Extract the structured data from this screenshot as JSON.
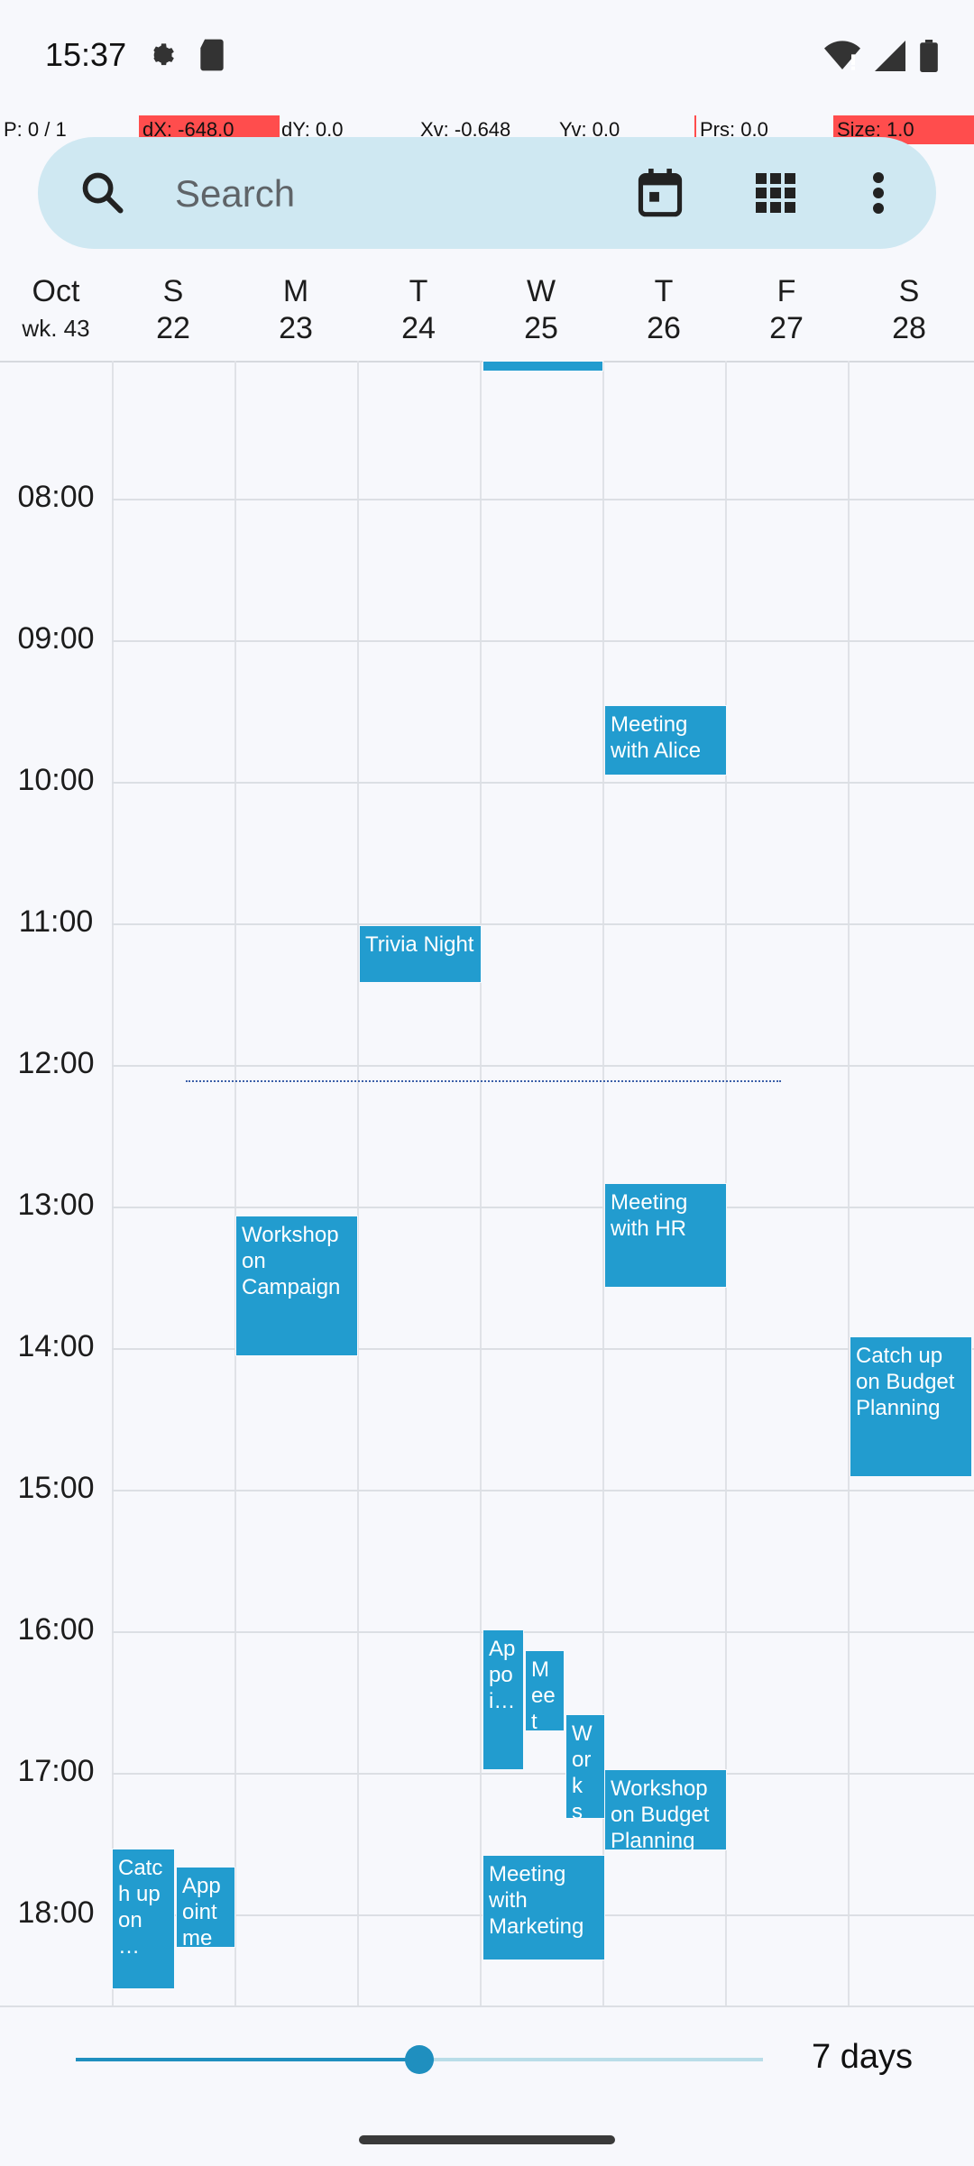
{
  "status_bar": {
    "time": "15:37",
    "icons": [
      "settings-icon",
      "sd-card-icon",
      "wifi-icon",
      "signal-icon",
      "battery-icon"
    ]
  },
  "debug": {
    "p": "P: 0 / 1",
    "dx": "dX: -648.0",
    "dy": "dY: 0.0",
    "xv": "Xv: -0.648",
    "yv": "Yv: 0.0",
    "prs": "Prs: 0.0",
    "size": "Size: 1.0"
  },
  "search": {
    "placeholder": "Search"
  },
  "toolbar": {
    "icons": [
      "calendar-today-icon",
      "grid-view-icon",
      "more-vert-icon"
    ]
  },
  "week_header": {
    "month": "Oct",
    "week": "wk. 43",
    "days": [
      {
        "letter": "S",
        "number": "22"
      },
      {
        "letter": "M",
        "number": "23"
      },
      {
        "letter": "T",
        "number": "24"
      },
      {
        "letter": "W",
        "number": "25"
      },
      {
        "letter": "T",
        "number": "26"
      },
      {
        "letter": "F",
        "number": "27"
      },
      {
        "letter": "S",
        "number": "28"
      }
    ]
  },
  "hours": [
    "08:00",
    "09:00",
    "10:00",
    "11:00",
    "12:00",
    "13:00",
    "14:00",
    "15:00",
    "16:00",
    "17:00",
    "18:00"
  ],
  "events": [
    {
      "title": "Meeting with Alice",
      "day": 4
    },
    {
      "title": "Trivia Night",
      "day": 2
    },
    {
      "title": "Meeting with HR",
      "day": 4
    },
    {
      "title": "Workshop on Campaign",
      "day": 1
    },
    {
      "title": "Catch up on Budget Planning",
      "day": 6
    },
    {
      "title": "Ap poi…",
      "day": 3
    },
    {
      "title": "M eet in…",
      "day": 3
    },
    {
      "title": "W ork s…",
      "day": 3
    },
    {
      "title": "Workshop on Budget Planning",
      "day": 4
    },
    {
      "title": "Catc h up on …",
      "day": 0
    },
    {
      "title": "App oint me…",
      "day": 0
    },
    {
      "title": "Meeting with Marketing",
      "day": 3
    }
  ],
  "bottom": {
    "days_label": "7 days",
    "slider_value": 0.5
  },
  "colors": {
    "event": "#229ccf",
    "search_bar": "#cfe8f2",
    "accent": "#1f8fbf",
    "debug_highlight": "#ff4d4d"
  }
}
